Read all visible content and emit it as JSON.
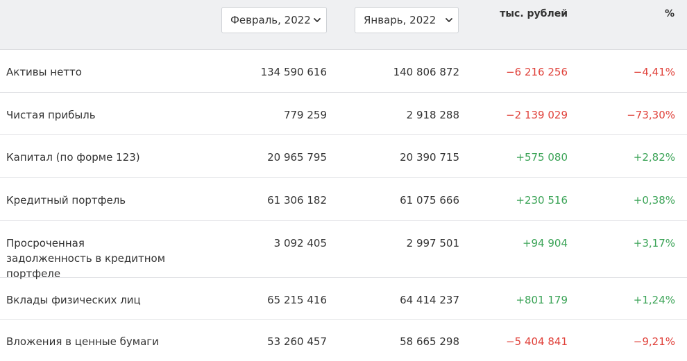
{
  "header": {
    "period1": "Февраль, 2022",
    "period2": "Январь, 2022",
    "units": "тыс. рублей",
    "percent": "%",
    "chevron_icon": "chevron-down-icon"
  },
  "colors": {
    "negative": "#e0413a",
    "positive": "#3aa356",
    "header_bg": "#eff0f2"
  },
  "rows": [
    {
      "name": "Активы нетто",
      "feb": "134 590 616",
      "jan": "140 806 872",
      "diff": "−6 216 256",
      "pct": "−4,41%",
      "trend": "neg"
    },
    {
      "name": "Чистая прибыль",
      "feb": "779 259",
      "jan": "2 918 288",
      "diff": "−2 139 029",
      "pct": "−73,30%",
      "trend": "neg"
    },
    {
      "name": "Капитал (по форме 123)",
      "feb": "20 965 795",
      "jan": "20 390 715",
      "diff": "+575 080",
      "pct": "+2,82%",
      "trend": "pos"
    },
    {
      "name": "Кредитный портфель",
      "feb": "61 306 182",
      "jan": "61 075 666",
      "diff": "+230 516",
      "pct": "+0,38%",
      "trend": "pos"
    },
    {
      "name": "Просроченная задолженность в кредитном портфеле",
      "feb": "3 092 405",
      "jan": "2 997 501",
      "diff": "+94 904",
      "pct": "+3,17%",
      "trend": "pos"
    },
    {
      "name": "Вклады физических лиц",
      "feb": "65 215 416",
      "jan": "64 414 237",
      "diff": "+801 179",
      "pct": "+1,24%",
      "trend": "pos"
    },
    {
      "name": "Вложения в ценные бумаги",
      "feb": "53 260 457",
      "jan": "58 665 298",
      "diff": "−5 404 841",
      "pct": "−9,21%",
      "trend": "neg"
    }
  ]
}
